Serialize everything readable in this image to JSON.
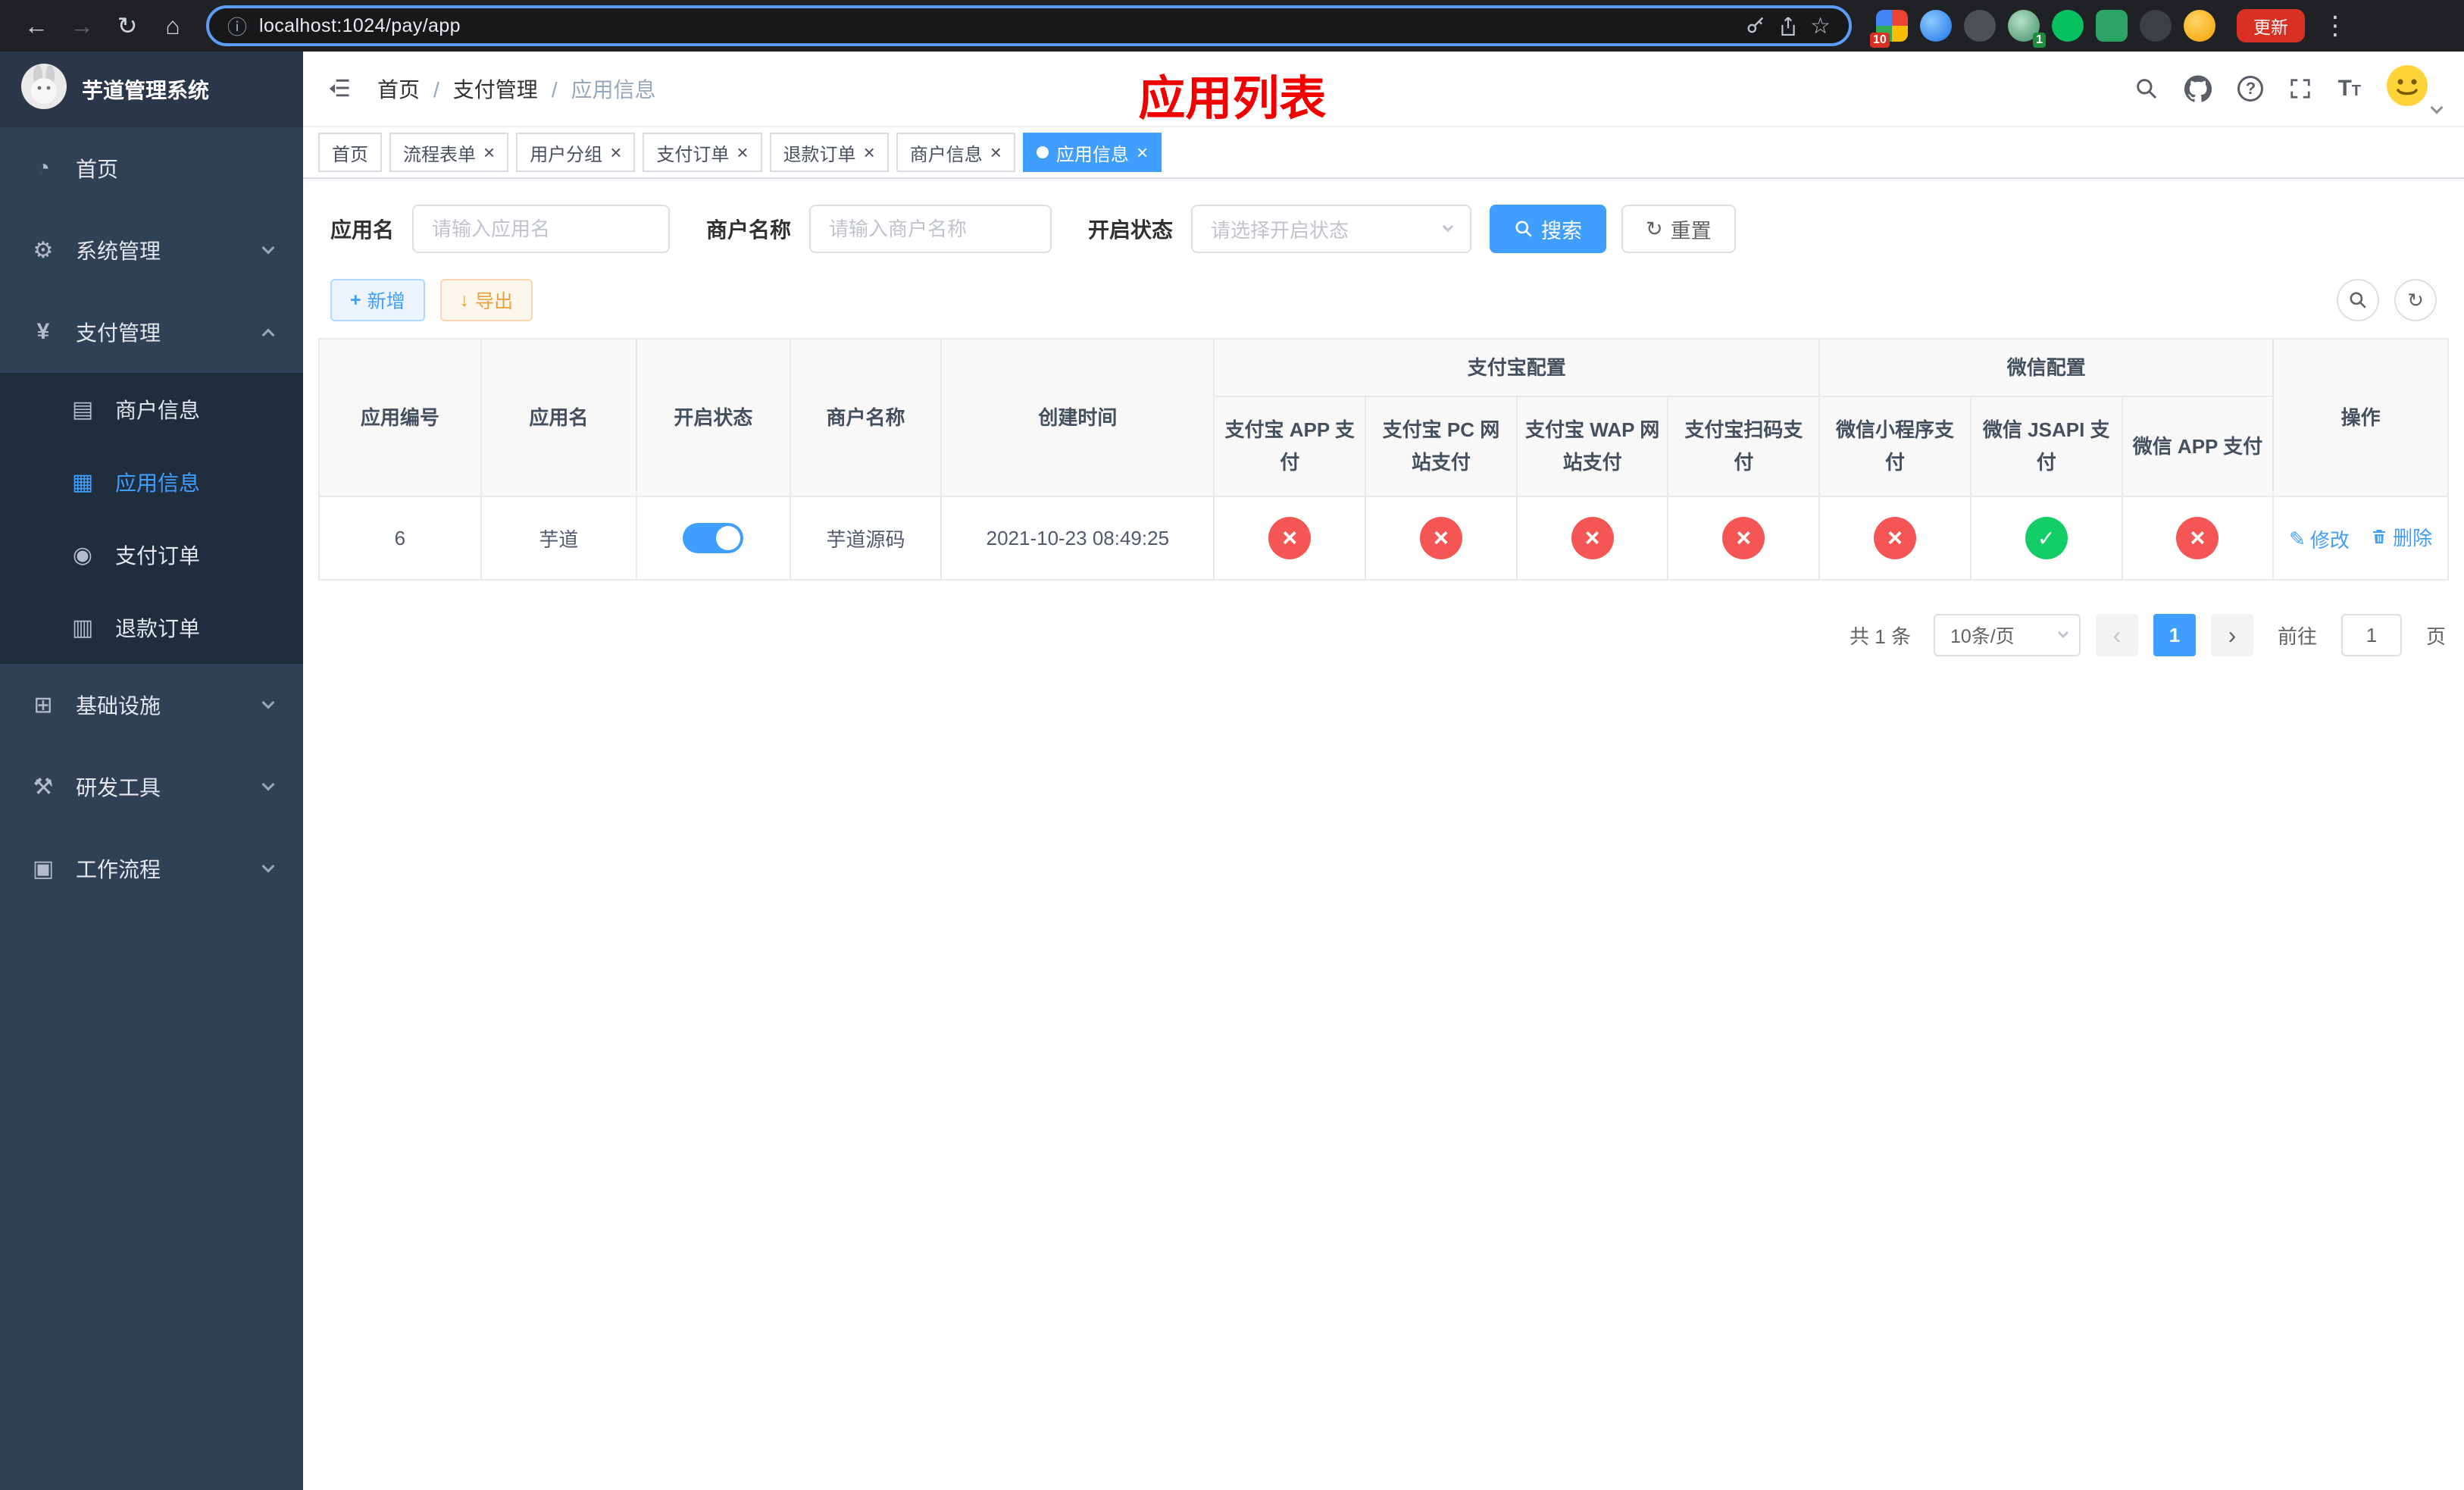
{
  "colors": {
    "primary": "#409eff",
    "success": "#13ce66",
    "danger": "#f45656",
    "warning": "#e6a23c",
    "page_title_red": "#f20000",
    "sidebar_bg": "#304156",
    "submenu_bg": "#1f2d3d"
  },
  "browser": {
    "url": "localhost:1024/pay/app",
    "update_button": "更新",
    "extension_badge_1": "10",
    "extension_badge_2": "1"
  },
  "sidebar": {
    "logo_title": "芋道管理系统",
    "items": [
      {
        "label": "首页"
      },
      {
        "label": "系统管理"
      },
      {
        "label": "支付管理"
      },
      {
        "label": "基础设施"
      },
      {
        "label": "研发工具"
      },
      {
        "label": "工作流程"
      }
    ],
    "submenu": [
      {
        "label": "商户信息"
      },
      {
        "label": "应用信息"
      },
      {
        "label": "支付订单"
      },
      {
        "label": "退款订单"
      }
    ]
  },
  "header": {
    "breadcrumb": [
      "首页",
      "支付管理",
      "应用信息"
    ],
    "page_title": "应用列表"
  },
  "tabs": [
    {
      "label": "首页"
    },
    {
      "label": "流程表单"
    },
    {
      "label": "用户分组"
    },
    {
      "label": "支付订单"
    },
    {
      "label": "退款订单"
    },
    {
      "label": "商户信息"
    },
    {
      "label": "应用信息"
    }
  ],
  "filters": {
    "app_name_label": "应用名",
    "app_name_placeholder": "请输入应用名",
    "merchant_label": "商户名称",
    "merchant_placeholder": "请输入商户名称",
    "status_label": "开启状态",
    "status_placeholder": "请选择开启状态",
    "search_button": "搜索",
    "reset_button": "重置"
  },
  "toolbar": {
    "add_button": "新增",
    "export_button": "导出"
  },
  "table": {
    "group_headers": {
      "alipay": "支付宝配置",
      "wechat": "微信配置"
    },
    "columns": {
      "app_id": "应用编号",
      "app_name": "应用名",
      "status": "开启状态",
      "merchant": "商户名称",
      "create_time": "创建时间",
      "alipay_app": "支付宝 APP 支付",
      "alipay_pc": "支付宝 PC 网站支付",
      "alipay_wap": "支付宝 WAP 网站支付",
      "alipay_qr": "支付宝扫码支付",
      "wx_mini": "微信小程序支付",
      "wx_jsapi": "微信 JSAPI 支付",
      "wx_app": "微信 APP 支付",
      "actions": "操作"
    },
    "row": {
      "app_id": "6",
      "app_name": "芋道",
      "status": "on",
      "merchant": "芋道源码",
      "create_time": "2021-10-23 08:49:25",
      "alipay_app": "error",
      "alipay_pc": "error",
      "alipay_wap": "error",
      "alipay_qr": "error",
      "wx_mini": "error",
      "wx_jsapi": "success",
      "wx_app": "error",
      "edit_link": "修改",
      "delete_link": "删除"
    }
  },
  "pagination": {
    "total_text": "共 1 条",
    "page_size": "10条/页",
    "current_page": "1",
    "goto_prefix": "前往",
    "goto_value": "1",
    "goto_suffix": "页"
  }
}
